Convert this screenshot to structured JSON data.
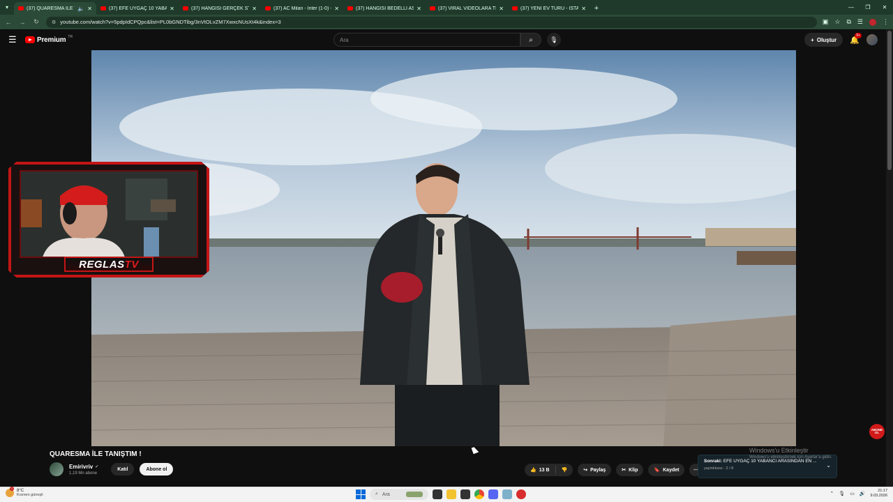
{
  "browser": {
    "tabs": [
      {
        "label": "(37) QUARESMA İLE TANIŞ",
        "active": true
      },
      {
        "label": "(37) EFE UYGAÇ 10 YABANCI AI"
      },
      {
        "label": "(37) HANGİSİ GERÇEK STAND-I"
      },
      {
        "label": "(37) AC Milan - Inter (1-0) - Ma"
      },
      {
        "label": "(37) HANGİSİ BEDELLİ ASKER D"
      },
      {
        "label": "(37) VİRAL VİDEOLARA TEPKİ"
      },
      {
        "label": "(37) YENİ EV TURU - İSTANBUL"
      }
    ],
    "url": "youtube.com/watch?v=5pdpIdCPQpc&list=PL0bGNDTibg/3nVtOLvZM7XwxcNUsXt4k&index=3"
  },
  "youtube": {
    "logo_text": "Premium",
    "country_code": "TR",
    "search_placeholder": "Ara",
    "create_label": "Oluştur",
    "notification_count": "9+"
  },
  "video": {
    "title": "QUARESMA İLE TANIŞTIM !",
    "channel_name": "Emirivriv",
    "subscribers": "1,19 Mn abone",
    "join_label": "Katıl",
    "subscribe_label": "Abone ol",
    "likes": "13 B",
    "share_label": "Paylaş",
    "clip_label": "Klip",
    "save_label": "Kaydet"
  },
  "overlay": {
    "webcam_logo_main": "REGLAS",
    "webcam_logo_tv": "TV",
    "corner_badge": "ABONE OL"
  },
  "next_up": {
    "prefix": "Sonraki:",
    "title": "EFE UYGAÇ 10 YABANCI ARASINDAN EN ...",
    "playlist": "yayinlıksss - 2 / 8"
  },
  "watermark": {
    "title": "Windows'u Etkinleştir",
    "subtitle": "Windows'u etkinleştirmek için Ayarlar'a gidin."
  },
  "taskbar": {
    "temperature": "8°C",
    "weather_desc": "Kısmen güneşli",
    "weather_badge": "1",
    "search_label": "Ara",
    "time": "21:17",
    "date": "9.03.2026"
  },
  "colors": {
    "youtube_red": "#ff0000",
    "chrome_frame": "#1f3a2a",
    "overlay_red": "#c41515"
  }
}
